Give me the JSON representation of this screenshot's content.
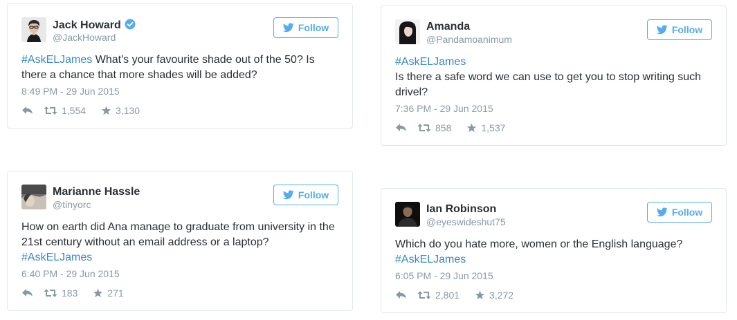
{
  "colors": {
    "accent": "#55acee",
    "hashtag": "#3b88c3",
    "meta": "#8899a6",
    "text": "#292f33",
    "border": "#e1e8ed"
  },
  "follow_label": "Follow",
  "tweets": [
    {
      "name": "Jack Howard",
      "handle": "@JackHoward",
      "verified": true,
      "hashtag": "#AskELJames",
      "text": "What's your favourite shade out of the 50? Is there a chance that more shades will be added?",
      "time": "8:49 PM - 29 Jun 2015",
      "retweets": "1,554",
      "favorites": "3,130"
    },
    {
      "name": "Amanda",
      "handle": "@Pandamoanimum",
      "verified": false,
      "hashtag": "#AskELJames",
      "text": "Is there a safe word we can use to get you to stop writing such drivel?",
      "time": "7:36 PM - 29 Jun 2015",
      "retweets": "858",
      "favorites": "1,537"
    },
    {
      "name": "Marianne Hassle",
      "handle": "@tinyorc",
      "verified": false,
      "hashtag": "#AskELJames",
      "text": "How on earth did Ana manage to graduate from university in the 21st century without an email address or a laptop?",
      "time": "6:40 PM - 29 Jun 2015",
      "retweets": "183",
      "favorites": "271"
    },
    {
      "name": "Ian Robinson",
      "handle": "@eyeswideshut75",
      "verified": false,
      "hashtag": "#AskELJames",
      "text": "Which do you hate more, women or the English language?",
      "time": "6:05 PM - 29 Jun 2015",
      "retweets": "2,801",
      "favorites": "3,272"
    }
  ]
}
